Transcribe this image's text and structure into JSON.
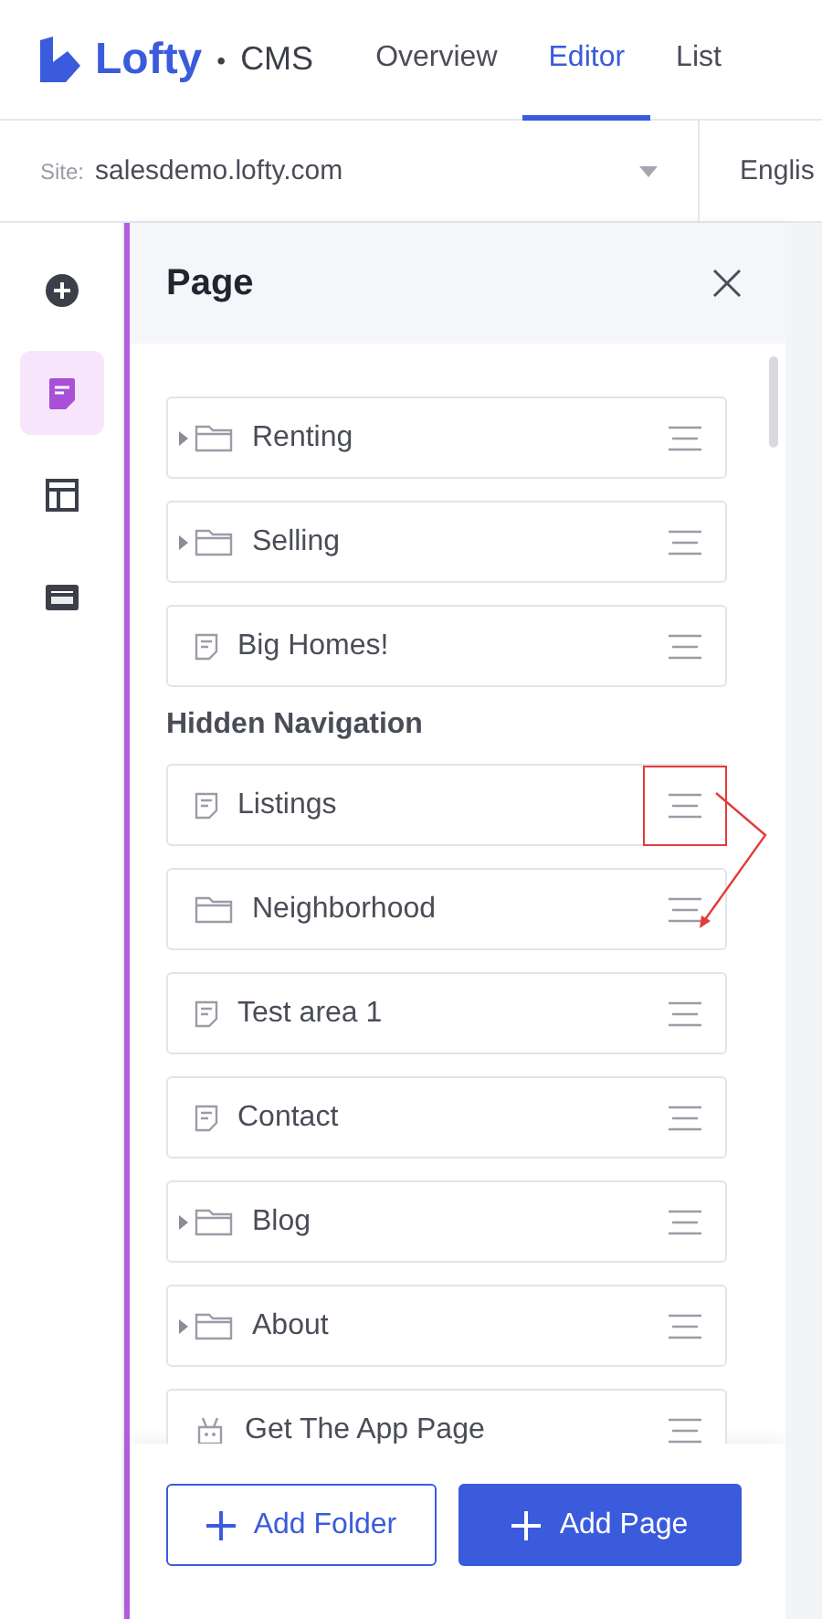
{
  "header": {
    "logo": "Lofty",
    "product": "CMS",
    "separator": "•",
    "nav": [
      {
        "label": "Overview",
        "selected": false
      },
      {
        "label": "Editor",
        "selected": true
      },
      {
        "label": "List",
        "selected": false
      }
    ]
  },
  "site_bar": {
    "label": "Site:",
    "value": "salesdemo.lofty.com",
    "language": "Englis"
  },
  "rail": [
    {
      "kind": "add",
      "selected": false
    },
    {
      "kind": "page",
      "selected": true
    },
    {
      "kind": "layout",
      "selected": false
    },
    {
      "kind": "seo",
      "selected": false
    }
  ],
  "panel": {
    "title": "Page",
    "sections": [
      {
        "items": [
          {
            "label": "Renting",
            "kind": "folder",
            "expandable": true,
            "highlighted": false
          },
          {
            "label": "Selling",
            "kind": "folder",
            "expandable": true,
            "highlighted": false
          },
          {
            "label": "Big Homes!",
            "kind": "page",
            "expandable": false,
            "highlighted": false
          }
        ]
      },
      {
        "heading": "Hidden Navigation",
        "items": [
          {
            "label": "Listings",
            "kind": "page",
            "expandable": false,
            "highlighted": true
          },
          {
            "label": "Neighborhood",
            "kind": "folder",
            "expandable": false,
            "highlighted": false
          },
          {
            "label": "Test area 1",
            "kind": "page",
            "expandable": false,
            "highlighted": false
          },
          {
            "label": "Contact",
            "kind": "page",
            "expandable": false,
            "highlighted": false
          },
          {
            "label": "Blog",
            "kind": "folder",
            "expandable": true,
            "highlighted": false
          },
          {
            "label": "About",
            "kind": "folder",
            "expandable": true,
            "highlighted": false
          },
          {
            "label": "Get The App Page",
            "kind": "app",
            "expandable": false,
            "highlighted": false
          }
        ]
      }
    ],
    "buttons": [
      {
        "label": "Add Folder",
        "kind": "secondary"
      },
      {
        "label": "Add Page",
        "kind": "primary"
      }
    ]
  }
}
